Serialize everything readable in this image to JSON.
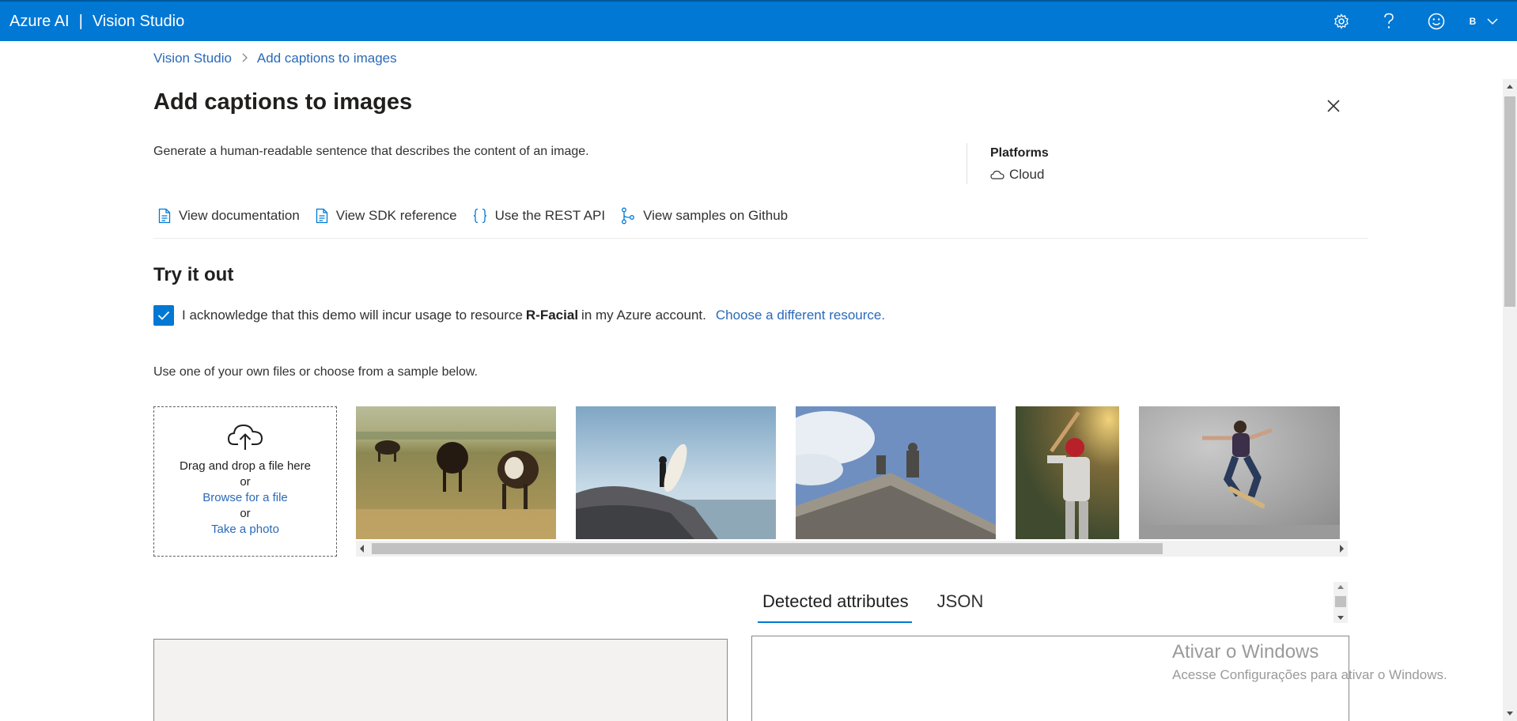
{
  "topbar": {
    "brand": "Azure AI",
    "separator": "|",
    "product": "Vision Studio",
    "user_initial": "B",
    "icons": [
      "gear-icon",
      "help-icon",
      "feedback-smiley-icon",
      "chevron-down-icon"
    ]
  },
  "breadcrumb": {
    "root": "Vision Studio",
    "current": "Add captions to images"
  },
  "page": {
    "title": "Add captions to images",
    "description": "Generate a human-readable sentence that describes the content of an image.",
    "platforms_title": "Platforms",
    "platform": "Cloud"
  },
  "links": [
    {
      "label": "View documentation",
      "icon": "document-icon"
    },
    {
      "label": "View SDK reference",
      "icon": "document-icon"
    },
    {
      "label": "Use the REST API",
      "icon": "braces-icon"
    },
    {
      "label": "View samples on Github",
      "icon": "branch-icon"
    }
  ],
  "try_it": {
    "title": "Try it out",
    "ack_prefix": "I acknowledge that this demo will incur usage to resource",
    "resource": "R-Facial",
    "ack_suffix": "in my Azure account.",
    "change_resource": "Choose a different resource.",
    "checked": true,
    "hint": "Use one of your own files or choose from a sample below."
  },
  "upload": {
    "drag_text": "Drag and drop a file here",
    "or1": "or",
    "browse": "Browse for a file",
    "or2": "or",
    "take_photo": "Take a photo"
  },
  "samples": [
    "cows-grazing-image",
    "surfer-on-rock-image",
    "building-statue-image",
    "baseball-batter-image",
    "skateboarder-image"
  ],
  "results": {
    "tabs": [
      "Detected attributes",
      "JSON"
    ],
    "active_tab": "Detected attributes"
  },
  "watermark": {
    "title": "Ativar o Windows",
    "subtitle": "Acesse Configurações para ativar o Windows."
  },
  "colors": {
    "accent": "#0078d4",
    "link": "#2a6ab8"
  }
}
